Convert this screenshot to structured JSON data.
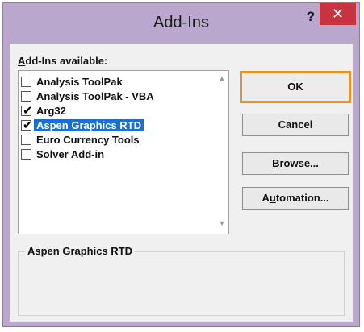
{
  "window": {
    "title": "Add-Ins",
    "help_label": "?",
    "close_label": "✕"
  },
  "list": {
    "label_prefix": "A",
    "label_rest": "dd-Ins available:",
    "items": [
      {
        "label": "Analysis ToolPak",
        "checked": false,
        "selected": false
      },
      {
        "label": "Analysis ToolPak - VBA",
        "checked": false,
        "selected": false
      },
      {
        "label": "Arg32",
        "checked": true,
        "selected": false
      },
      {
        "label": "Aspen Graphics RTD",
        "checked": true,
        "selected": true
      },
      {
        "label": "Euro Currency Tools",
        "checked": false,
        "selected": false
      },
      {
        "label": "Solver Add-in",
        "checked": false,
        "selected": false
      }
    ],
    "check_glyph": "✔",
    "scroll_up_icon": "▲",
    "scroll_down_icon": "▼"
  },
  "buttons": {
    "ok": "OK",
    "cancel": "Cancel",
    "browse_prefix": "B",
    "browse_rest": "rowse...",
    "automation_prefix": "A",
    "automation_u": "u",
    "automation_rest": "tomation..."
  },
  "description": {
    "title": "Aspen Graphics RTD"
  },
  "colors": {
    "selection": "#1a6fd6",
    "default_button_border": "#e8941f",
    "close_button": "#c7343f",
    "window_frame": "#b9a7ce"
  }
}
